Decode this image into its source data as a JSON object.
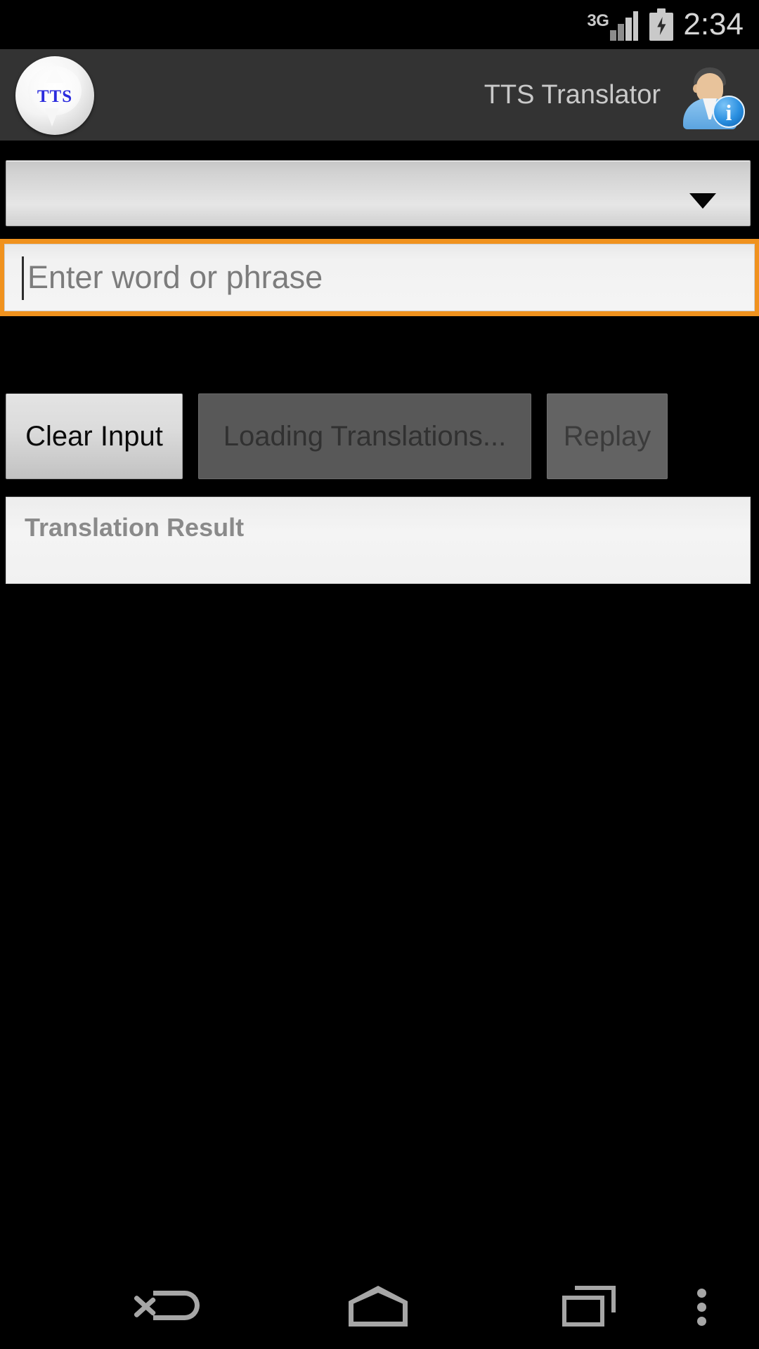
{
  "status_bar": {
    "network_type": "3G",
    "signal_icon": "signal-bars-icon",
    "battery_icon": "battery-charging-icon",
    "time": "2:34"
  },
  "title_bar": {
    "logo_text": "TTS",
    "logo_icon": "tts-speech-bubble-logo",
    "title": "TTS Translator",
    "avatar_icon": "user-info-avatar-icon",
    "background_color": "#333333",
    "title_color": "#c9c9c9"
  },
  "language_spinner": {
    "selected_value": "",
    "arrow_icon": "dropdown-triangle-icon"
  },
  "text_input": {
    "value": "",
    "placeholder": "Enter word or phrase",
    "focused": true,
    "focus_color": "#f0921e"
  },
  "buttons": {
    "clear": {
      "label": "Clear Input",
      "enabled": true
    },
    "translate": {
      "label": "Loading Translations...",
      "enabled": false
    },
    "replay": {
      "label": "Replay",
      "enabled": false
    }
  },
  "result_panel": {
    "label": "Translation Result"
  },
  "nav_bar": {
    "back": "back-icon",
    "home": "home-icon",
    "recents": "recents-icon",
    "more": "overflow-menu-icon"
  }
}
